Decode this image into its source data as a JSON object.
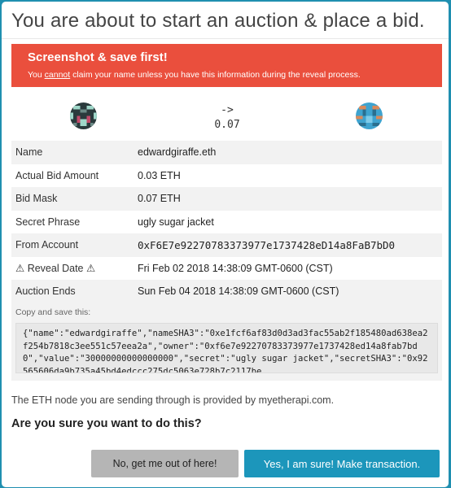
{
  "modal": {
    "title": "You are about to start an auction & place a bid."
  },
  "alert": {
    "heading": "Screenshot & save first!",
    "body_prefix": "You ",
    "body_emphasis": "cannot",
    "body_suffix": " claim your name unless you have this information during the reveal process."
  },
  "transfer": {
    "arrow": "->",
    "amount": "0.07"
  },
  "details": [
    {
      "label": "Name",
      "value": "edwardgiraffe.eth"
    },
    {
      "label": "Actual Bid Amount",
      "value": "0.03 ETH"
    },
    {
      "label": "Bid Mask",
      "value": "0.07 ETH"
    },
    {
      "label": "Secret Phrase",
      "value": "ugly sugar jacket"
    },
    {
      "label": "From Account",
      "value": "0xF6E7e92270783373977e1737428eD14a8FaB7bD0"
    },
    {
      "label": "Reveal Date",
      "warn_icon": "⚠",
      "value": "Fri Feb 02 2018 14:38:09 GMT-0600 (CST)"
    },
    {
      "label": "Auction Ends",
      "value": "Sun Feb 04 2018 14:38:09 GMT-0600 (CST)"
    }
  ],
  "copy": {
    "label": "Copy and save this:",
    "text": "{\"name\":\"edwardgiraffe\",\"nameSHA3\":\"0xe1fcf6af83d0d3ad3fac55ab2f185480ad638ea2f254b7818c3ee551c57eea2a\",\"owner\":\"0xf6e7e92270783373977e1737428ed14a8fab7bd0\",\"value\":\"30000000000000000\",\"secret\":\"ugly sugar jacket\",\"secretSHA3\":\"0x92565606da9b735a45bd4edccc275dc5063e728b7c2117be"
  },
  "node": {
    "prefix": "The ",
    "eth": "ETH",
    "middle": " node you are sending through is provided by ",
    "provider": "myetherapi.com",
    "suffix": "."
  },
  "question": "Are you sure you want to do this?",
  "buttons": {
    "cancel": "No, get me out of here!",
    "confirm": "Yes, I am sure! Make transaction."
  },
  "colors": {
    "backdrop": "#1f8fb0",
    "alert": "#ea4f3d",
    "confirm": "#1c96bb",
    "cancel": "#b5b5b5",
    "warning": "#c0392b"
  },
  "icons": {
    "from_identicon": "blockie-identicon-dark",
    "to_identicon": "blockie-identicon-blue"
  }
}
